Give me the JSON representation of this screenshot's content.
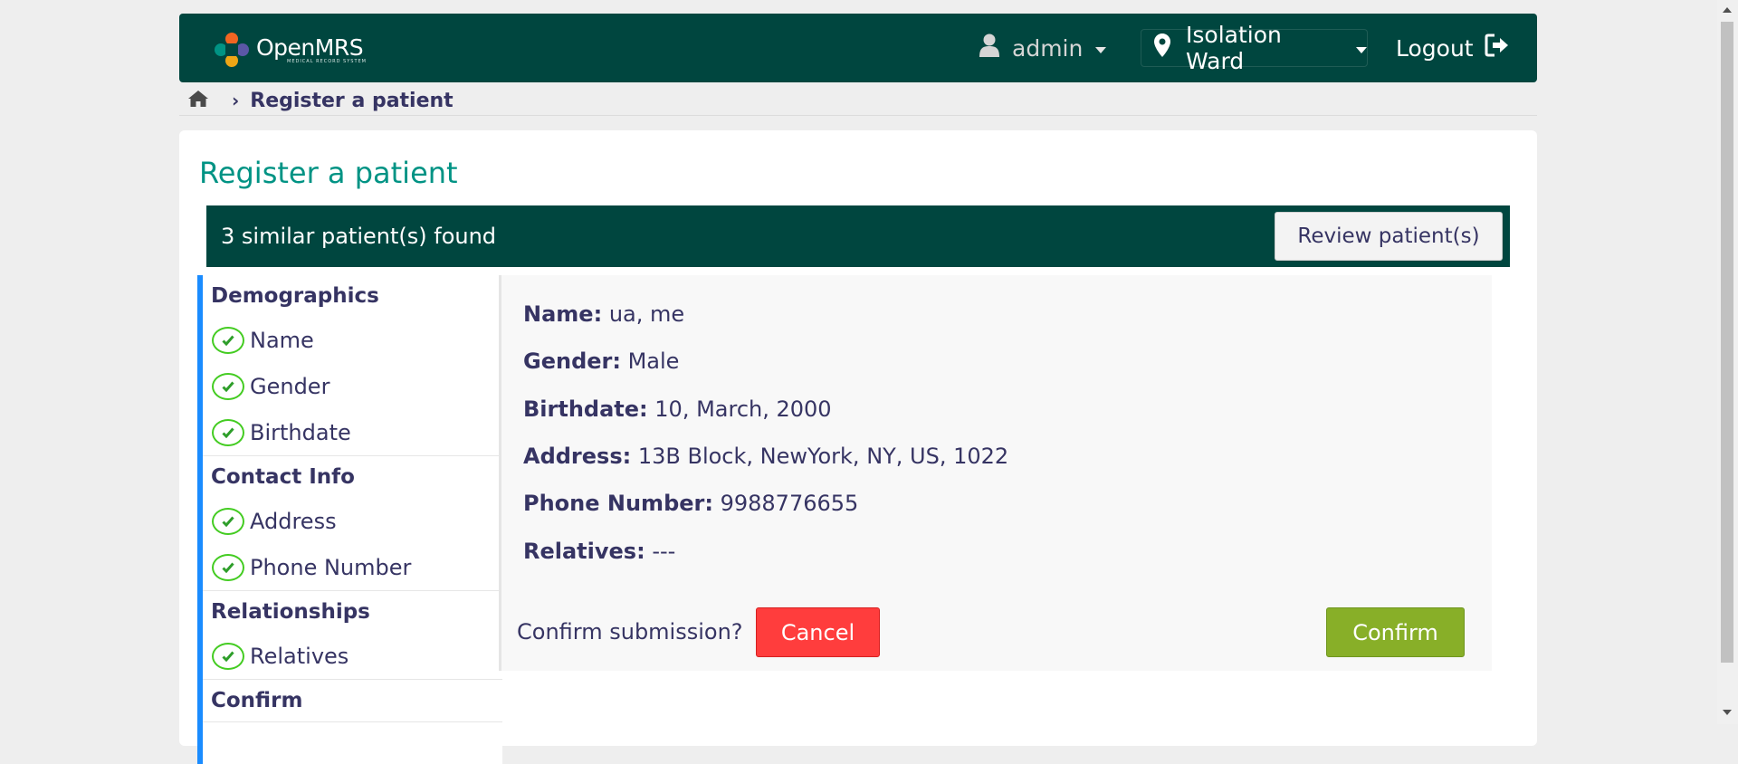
{
  "header": {
    "logo_name": "OpenMRS",
    "logo_sub": "MEDICAL RECORD SYSTEM",
    "user": {
      "icon": "user-icon",
      "label": "admin"
    },
    "location": {
      "icon": "map-marker-icon",
      "label": "Isolation Ward"
    },
    "logout": {
      "label": "Logout",
      "icon": "logout-icon"
    },
    "colors": {
      "bg": "#00463f",
      "text": "#ffffff"
    }
  },
  "breadcrumb": {
    "home_icon": "home-icon",
    "current": "Register a patient"
  },
  "page": {
    "title": "Register a patient"
  },
  "similar_banner": {
    "text": "3 similar patient(s) found",
    "button": "Review patient(s)"
  },
  "sidebar": {
    "sections": [
      {
        "heading": "Demographics",
        "items": [
          "Name",
          "Gender",
          "Birthdate"
        ]
      },
      {
        "heading": "Contact Info",
        "items": [
          "Address",
          "Phone Number"
        ]
      },
      {
        "heading": "Relationships",
        "items": [
          "Relatives"
        ]
      },
      {
        "heading": "Confirm",
        "items": []
      }
    ]
  },
  "summary": {
    "name": {
      "label": "Name:",
      "value": "ua, me"
    },
    "gender": {
      "label": "Gender:",
      "value": "Male"
    },
    "birthdate": {
      "label": "Birthdate:",
      "value": "10, March, 2000"
    },
    "address": {
      "label": "Address:",
      "value": "13B Block, NewYork, NY, US, 1022"
    },
    "phone": {
      "label": "Phone Number:",
      "value": "9988776655"
    },
    "relatives": {
      "label": "Relatives:",
      "value": "---"
    }
  },
  "actions": {
    "question": "Confirm submission?",
    "cancel": "Cancel",
    "confirm": "Confirm",
    "colors": {
      "cancel": "#ff3d3d",
      "confirm": "#88af28",
      "accent": "#009384"
    }
  }
}
